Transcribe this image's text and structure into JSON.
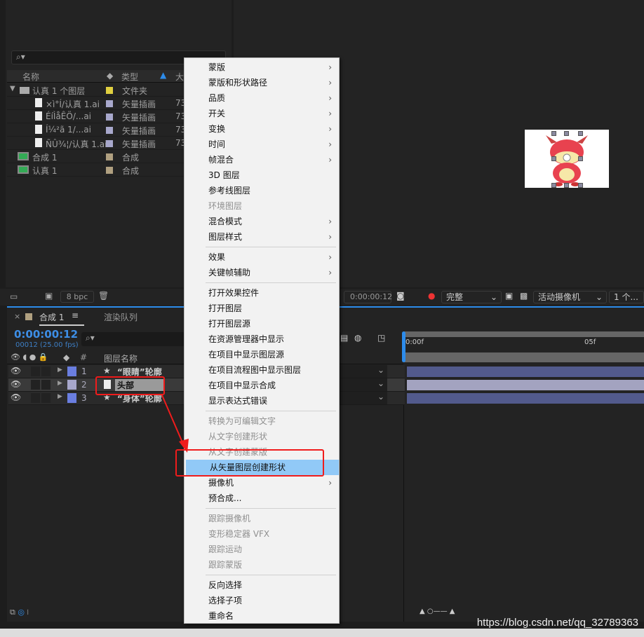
{
  "project": {
    "columns": {
      "name": "名称",
      "type": "类型",
      "size": "大"
    },
    "items": [
      {
        "name": "认真 1 个图层",
        "type": "文件夹",
        "size": "",
        "icon": "folder-icon",
        "label_color": "#e0d040",
        "indent": 0
      },
      {
        "name": "×ì°Í/认真 1.ai",
        "type": "矢量插画",
        "size": "73",
        "icon": "file-icon",
        "label_color": "#a8a8cc",
        "indent": 1
      },
      {
        "name": "ÉíÌåÊÖ/...ai",
        "type": "矢量插画",
        "size": "73",
        "icon": "file-icon",
        "label_color": "#a8a8cc",
        "indent": 1
      },
      {
        "name": "Í¼²ã 1/...ai",
        "type": "矢量插画",
        "size": "73",
        "icon": "file-icon",
        "label_color": "#a8a8cc",
        "indent": 1
      },
      {
        "name": "ÑÛ¾¦/认真 1.ai",
        "type": "矢量插画",
        "size": "73",
        "icon": "file-icon",
        "label_color": "#a8a8cc",
        "indent": 1
      },
      {
        "name": "合成 1",
        "type": "合成",
        "size": "",
        "icon": "composition-icon",
        "label_color": "#b0a080",
        "indent": 0
      },
      {
        "name": "认真 1",
        "type": "合成",
        "size": "",
        "icon": "composition-icon",
        "label_color": "#b0a080",
        "indent": 0
      }
    ],
    "bpc": "8 bpc"
  },
  "viewer": {
    "timecode": "0:00:00:12",
    "quality": "完整",
    "camera": "活动摄像机",
    "views": "1 个..."
  },
  "timeline": {
    "tabs": [
      {
        "label": "合成 1"
      },
      {
        "label": "渲染队列"
      }
    ],
    "time": "0:00:00:12",
    "fps": "00012 (25.00 fps)",
    "header": {
      "num": "#",
      "layer_name": "图层名称"
    },
    "ruler": [
      "0:00f",
      "05f"
    ],
    "layers": [
      {
        "num": "1",
        "name": "“眼睛”轮廓",
        "icon": "star-icon",
        "color": "#6a7ee0",
        "selected": false
      },
      {
        "num": "2",
        "name": "头部",
        "icon": "file-icon",
        "color": "#a8a8cc",
        "selected": true
      },
      {
        "num": "3",
        "name": "“身体”轮廓",
        "icon": "star-icon",
        "color": "#6a7ee0",
        "selected": false
      }
    ]
  },
  "menu": {
    "items": [
      {
        "label": "蒙版",
        "sub": true
      },
      {
        "label": "蒙版和形状路径",
        "sub": true
      },
      {
        "label": "品质",
        "sub": true
      },
      {
        "label": "开关",
        "sub": true
      },
      {
        "label": "变换",
        "sub": true
      },
      {
        "label": "时间",
        "sub": true
      },
      {
        "label": "帧混合",
        "sub": true
      },
      {
        "label": "3D 图层"
      },
      {
        "label": "参考线图层"
      },
      {
        "label": "环境图层",
        "disabled": true
      },
      {
        "label": "混合模式",
        "sub": true
      },
      {
        "label": "图层样式",
        "sub": true
      },
      {
        "sep": true
      },
      {
        "label": "效果",
        "sub": true
      },
      {
        "label": "关键帧辅助",
        "sub": true
      },
      {
        "sep": true
      },
      {
        "label": "打开效果控件"
      },
      {
        "label": "打开图层"
      },
      {
        "label": "打开图层源"
      },
      {
        "label": "在资源管理器中显示"
      },
      {
        "label": "在项目中显示图层源"
      },
      {
        "label": "在项目流程图中显示图层"
      },
      {
        "label": "在项目中显示合成"
      },
      {
        "label": "显示表达式错误"
      },
      {
        "sep": true
      },
      {
        "label": "转换为可编辑文字",
        "disabled": true
      },
      {
        "label": "从文字创建形状",
        "disabled": true
      },
      {
        "label": "从文字创建蒙版",
        "disabled": true
      },
      {
        "label": "从矢量图层创建形状",
        "highlighted": true
      },
      {
        "label": "摄像机",
        "sub": true
      },
      {
        "label": "预合成..."
      },
      {
        "sep": true
      },
      {
        "label": "跟踪摄像机",
        "disabled": true
      },
      {
        "label": "变形稳定器 VFX",
        "disabled": true
      },
      {
        "label": "跟踪运动",
        "disabled": true
      },
      {
        "label": "跟踪蒙版",
        "disabled": true
      },
      {
        "sep": true
      },
      {
        "label": "反向选择"
      },
      {
        "label": "选择子项"
      },
      {
        "label": "重命名"
      }
    ]
  },
  "watermark": "https://blog.csdn.net/qq_32789363",
  "colors": {
    "accent": "#2d8ceb",
    "highlight": "#91c9f7",
    "annotation": "#f01c1c"
  }
}
